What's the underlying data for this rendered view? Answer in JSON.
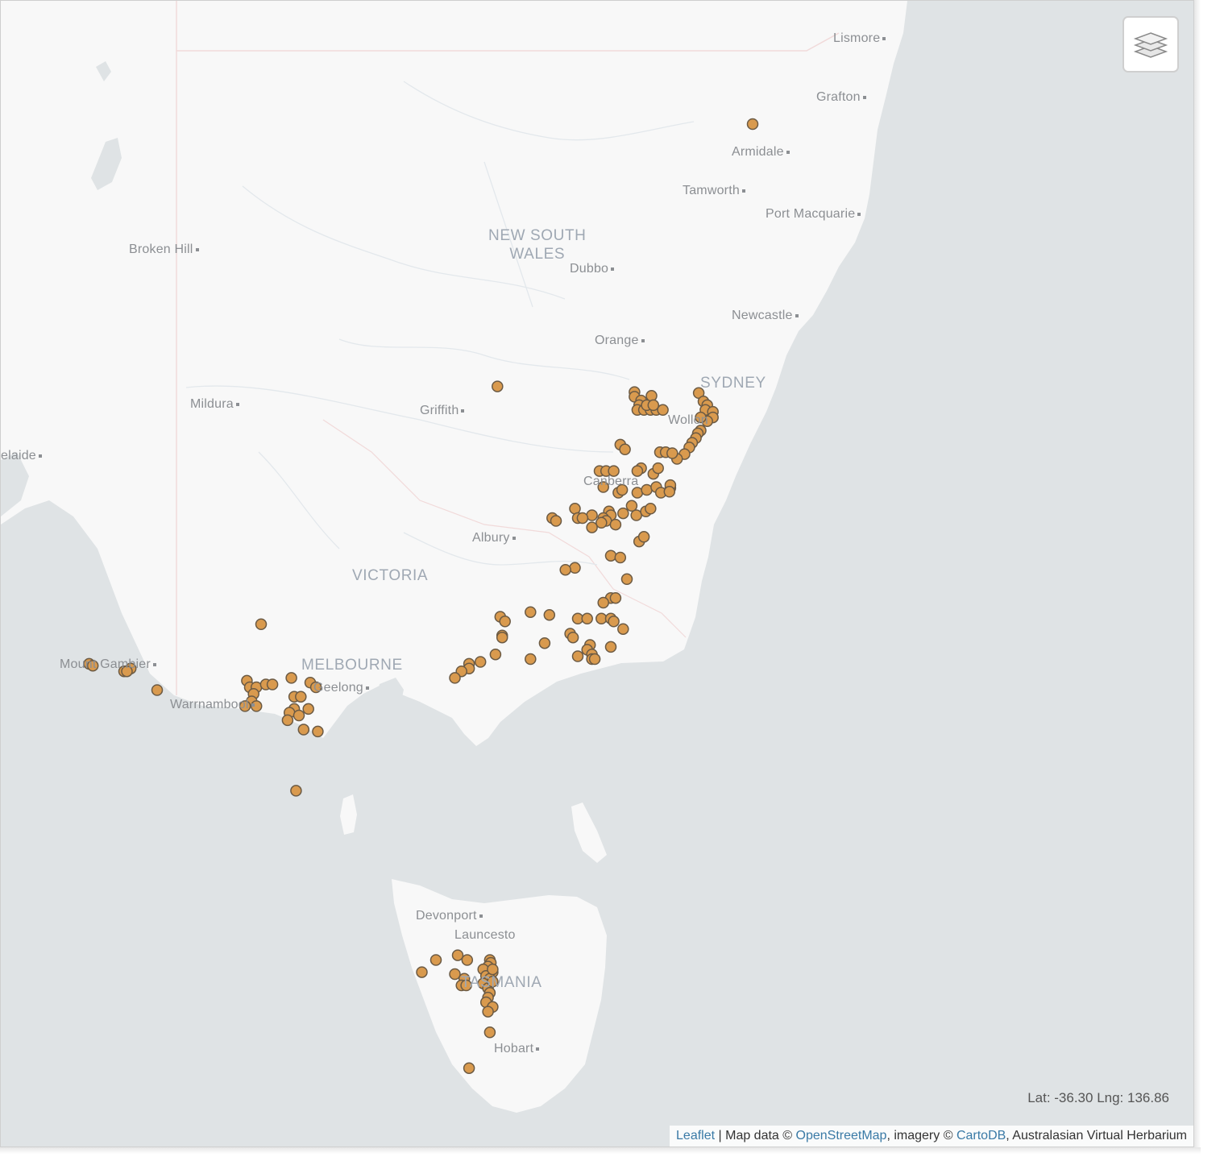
{
  "map": {
    "places": [
      {
        "id": "lismore",
        "name": "Lismore",
        "dot": true
      },
      {
        "id": "grafton",
        "name": "Grafton",
        "dot": true
      },
      {
        "id": "armidale",
        "name": "Armidale",
        "dot": true
      },
      {
        "id": "tamworth",
        "name": "Tamworth",
        "dot": true
      },
      {
        "id": "port-macquarie",
        "name": "Port Macquarie",
        "dot": true
      },
      {
        "id": "broken-hill",
        "name": "Broken Hill",
        "dot": true
      },
      {
        "id": "dubbo",
        "name": "Dubbo",
        "dot": true
      },
      {
        "id": "newcastle",
        "name": "Newcastle",
        "dot": true
      },
      {
        "id": "orange",
        "name": "Orange",
        "dot": true
      },
      {
        "id": "mildura",
        "name": "Mildura",
        "dot": true
      },
      {
        "id": "griffith",
        "name": "Griffith",
        "dot": true
      },
      {
        "id": "wollongong",
        "name": "Wollon",
        "dot": false
      },
      {
        "id": "canberra",
        "name": "Canberra",
        "dot": false
      },
      {
        "id": "adelaide",
        "name": "elaide",
        "dot": true
      },
      {
        "id": "albury",
        "name": "Albury",
        "dot": true
      },
      {
        "id": "mount-gambier",
        "name": "Mount Gambier",
        "dot": true
      },
      {
        "id": "geelong",
        "name": "Geelong",
        "dot": true
      },
      {
        "id": "warrnambool",
        "name": "Warrnambool",
        "dot": true
      },
      {
        "id": "devonport",
        "name": "Devonport",
        "dot": true
      },
      {
        "id": "launceston",
        "name": "Launcesto",
        "dot": false
      },
      {
        "id": "hobart",
        "name": "Hobart",
        "dot": true
      }
    ],
    "regions": [
      {
        "id": "nsw",
        "name": "NEW SOUTH\nWALES"
      },
      {
        "id": "victoria",
        "name": "VICTORIA"
      },
      {
        "id": "melbourne",
        "name": "MELBOURNE"
      },
      {
        "id": "sydney",
        "name": "SYDNEY"
      },
      {
        "id": "tasmania",
        "name": "TASMANIA"
      }
    ],
    "marker_style": {
      "fill": "#d99a4e",
      "stroke": "#6b5a44"
    },
    "occurrences": [
      {
        "lat": -30.46,
        "lng": 151.8
      },
      {
        "lat": -33.25,
        "lng": 149.1
      },
      {
        "lat": -33.31,
        "lng": 150.55
      },
      {
        "lat": -33.36,
        "lng": 150.55
      },
      {
        "lat": -33.4,
        "lng": 150.62
      },
      {
        "lat": -33.35,
        "lng": 150.73
      },
      {
        "lat": -33.45,
        "lng": 150.6
      },
      {
        "lat": -33.5,
        "lng": 150.58
      },
      {
        "lat": -33.5,
        "lng": 150.65
      },
      {
        "lat": -33.5,
        "lng": 150.72
      },
      {
        "lat": -33.5,
        "lng": 150.78
      },
      {
        "lat": -33.5,
        "lng": 150.85
      },
      {
        "lat": -33.45,
        "lng": 150.68
      },
      {
        "lat": -33.45,
        "lng": 150.75
      },
      {
        "lat": -33.32,
        "lng": 151.23
      },
      {
        "lat": -33.41,
        "lng": 151.28
      },
      {
        "lat": -33.45,
        "lng": 151.32
      },
      {
        "lat": -33.5,
        "lng": 151.3
      },
      {
        "lat": -33.52,
        "lng": 151.38
      },
      {
        "lat": -33.58,
        "lng": 151.38
      },
      {
        "lat": -33.62,
        "lng": 151.32
      },
      {
        "lat": -33.58,
        "lng": 151.25
      },
      {
        "lat": -33.72,
        "lng": 151.25
      },
      {
        "lat": -33.75,
        "lng": 151.22
      },
      {
        "lat": -33.8,
        "lng": 151.2
      },
      {
        "lat": -33.85,
        "lng": 151.16
      },
      {
        "lat": -33.9,
        "lng": 151.13
      },
      {
        "lat": -33.97,
        "lng": 151.08
      },
      {
        "lat": -34.02,
        "lng": 151.0
      },
      {
        "lat": -33.87,
        "lng": 150.4
      },
      {
        "lat": -33.92,
        "lng": 150.45
      },
      {
        "lat": -33.95,
        "lng": 150.82
      },
      {
        "lat": -33.95,
        "lng": 150.88
      },
      {
        "lat": -33.96,
        "lng": 150.95
      },
      {
        "lat": -34.15,
        "lng": 150.18
      },
      {
        "lat": -34.15,
        "lng": 150.25
      },
      {
        "lat": -34.15,
        "lng": 150.33
      },
      {
        "lat": -34.12,
        "lng": 150.62
      },
      {
        "lat": -34.15,
        "lng": 150.58
      },
      {
        "lat": -34.18,
        "lng": 150.75
      },
      {
        "lat": -34.12,
        "lng": 150.8
      },
      {
        "lat": -34.32,
        "lng": 150.22
      },
      {
        "lat": -34.38,
        "lng": 150.38
      },
      {
        "lat": -34.35,
        "lng": 150.42
      },
      {
        "lat": -34.38,
        "lng": 150.58
      },
      {
        "lat": -34.35,
        "lng": 150.68
      },
      {
        "lat": -34.32,
        "lng": 150.78
      },
      {
        "lat": -34.38,
        "lng": 150.83
      },
      {
        "lat": -34.33,
        "lng": 150.93
      },
      {
        "lat": -34.3,
        "lng": 150.93
      },
      {
        "lat": -34.37,
        "lng": 150.92
      },
      {
        "lat": -34.55,
        "lng": 149.92
      },
      {
        "lat": -34.65,
        "lng": 149.68
      },
      {
        "lat": -34.68,
        "lng": 149.72
      },
      {
        "lat": -34.65,
        "lng": 149.95
      },
      {
        "lat": -34.62,
        "lng": 150.1
      },
      {
        "lat": -34.58,
        "lng": 150.28
      },
      {
        "lat": -34.62,
        "lng": 150.3
      },
      {
        "lat": -34.65,
        "lng": 150.22
      },
      {
        "lat": -34.68,
        "lng": 150.25
      },
      {
        "lat": -34.72,
        "lng": 150.35
      },
      {
        "lat": -34.6,
        "lng": 150.43
      },
      {
        "lat": -34.62,
        "lng": 150.57
      },
      {
        "lat": -34.52,
        "lng": 150.52
      },
      {
        "lat": -34.58,
        "lng": 150.67
      },
      {
        "lat": -34.55,
        "lng": 150.72
      },
      {
        "lat": -34.7,
        "lng": 150.2
      },
      {
        "lat": -34.75,
        "lng": 150.1
      },
      {
        "lat": -34.65,
        "lng": 150.0
      },
      {
        "lat": -34.9,
        "lng": 150.6
      },
      {
        "lat": -34.85,
        "lng": 150.65
      },
      {
        "lat": -35.05,
        "lng": 150.3
      },
      {
        "lat": -35.07,
        "lng": 150.4
      },
      {
        "lat": -35.18,
        "lng": 149.92
      },
      {
        "lat": -35.2,
        "lng": 149.82
      },
      {
        "lat": -35.3,
        "lng": 150.47
      },
      {
        "lat": -35.5,
        "lng": 150.3
      },
      {
        "lat": -35.5,
        "lng": 150.35
      },
      {
        "lat": -35.55,
        "lng": 150.22
      },
      {
        "lat": -35.65,
        "lng": 149.45
      },
      {
        "lat": -35.68,
        "lng": 149.65
      },
      {
        "lat": -35.7,
        "lng": 149.13
      },
      {
        "lat": -35.75,
        "lng": 149.18
      },
      {
        "lat": -35.72,
        "lng": 149.95
      },
      {
        "lat": -35.72,
        "lng": 150.05
      },
      {
        "lat": -35.72,
        "lng": 150.2
      },
      {
        "lat": -35.72,
        "lng": 150.3
      },
      {
        "lat": -35.75,
        "lng": 150.33
      },
      {
        "lat": -35.83,
        "lng": 150.43
      },
      {
        "lat": -35.88,
        "lng": 149.87
      },
      {
        "lat": -35.92,
        "lng": 149.9
      },
      {
        "lat": -35.98,
        "lng": 149.6
      },
      {
        "lat": -35.9,
        "lng": 149.15
      },
      {
        "lat": -35.92,
        "lng": 149.15
      },
      {
        "lat": -36.0,
        "lng": 150.08
      },
      {
        "lat": -36.05,
        "lng": 150.05
      },
      {
        "lat": -36.1,
        "lng": 150.1
      },
      {
        "lat": -36.02,
        "lng": 150.3
      },
      {
        "lat": -36.12,
        "lng": 149.95
      },
      {
        "lat": -36.15,
        "lng": 150.1
      },
      {
        "lat": -36.15,
        "lng": 150.13
      },
      {
        "lat": -36.1,
        "lng": 149.08
      },
      {
        "lat": -36.15,
        "lng": 149.45
      },
      {
        "lat": -36.2,
        "lng": 148.8
      },
      {
        "lat": -36.18,
        "lng": 148.92
      },
      {
        "lat": -36.25,
        "lng": 148.8
      },
      {
        "lat": -36.28,
        "lng": 148.72
      },
      {
        "lat": -36.35,
        "lng": 148.65
      },
      {
        "lat": -35.78,
        "lng": 146.6
      },
      {
        "lat": -36.2,
        "lng": 144.78
      },
      {
        "lat": -36.22,
        "lng": 144.82
      },
      {
        "lat": -36.28,
        "lng": 145.15
      },
      {
        "lat": -36.25,
        "lng": 145.22
      },
      {
        "lat": -36.28,
        "lng": 145.18
      },
      {
        "lat": -36.48,
        "lng": 145.5
      },
      {
        "lat": -36.38,
        "lng": 146.45
      },
      {
        "lat": -36.45,
        "lng": 146.48
      },
      {
        "lat": -36.45,
        "lng": 146.55
      },
      {
        "lat": -36.42,
        "lng": 146.65
      },
      {
        "lat": -36.42,
        "lng": 146.72
      },
      {
        "lat": -36.52,
        "lng": 146.52
      },
      {
        "lat": -36.6,
        "lng": 146.5
      },
      {
        "lat": -36.65,
        "lng": 146.43
      },
      {
        "lat": -36.65,
        "lng": 146.55
      },
      {
        "lat": -36.35,
        "lng": 146.92
      },
      {
        "lat": -36.4,
        "lng": 147.12
      },
      {
        "lat": -36.45,
        "lng": 147.18
      },
      {
        "lat": -36.55,
        "lng": 146.95
      },
      {
        "lat": -36.55,
        "lng": 147.02
      },
      {
        "lat": -36.68,
        "lng": 146.95
      },
      {
        "lat": -36.72,
        "lng": 146.9
      },
      {
        "lat": -36.75,
        "lng": 147.0
      },
      {
        "lat": -36.68,
        "lng": 147.1
      },
      {
        "lat": -36.8,
        "lng": 146.88
      },
      {
        "lat": -36.92,
        "lng": 147.2
      },
      {
        "lat": -36.9,
        "lng": 147.05
      },
      {
        "lat": -37.55,
        "lng": 146.97
      },
      {
        "lat": -39.35,
        "lng": 148.45
      },
      {
        "lat": -39.3,
        "lng": 148.68
      },
      {
        "lat": -39.35,
        "lng": 148.78
      },
      {
        "lat": -39.48,
        "lng": 148.3
      },
      {
        "lat": -39.5,
        "lng": 148.65
      },
      {
        "lat": -39.55,
        "lng": 148.75
      },
      {
        "lat": -39.62,
        "lng": 148.72
      },
      {
        "lat": -39.62,
        "lng": 148.77
      },
      {
        "lat": -39.35,
        "lng": 149.02
      },
      {
        "lat": -39.38,
        "lng": 149.03
      },
      {
        "lat": -39.42,
        "lng": 149.0
      },
      {
        "lat": -39.45,
        "lng": 148.95
      },
      {
        "lat": -39.48,
        "lng": 149.05
      },
      {
        "lat": -39.52,
        "lng": 148.98
      },
      {
        "lat": -39.55,
        "lng": 149.02
      },
      {
        "lat": -39.6,
        "lng": 148.95
      },
      {
        "lat": -39.65,
        "lng": 149.0
      },
      {
        "lat": -39.7,
        "lng": 149.02
      },
      {
        "lat": -39.75,
        "lng": 149.0
      },
      {
        "lat": -39.8,
        "lng": 148.98
      },
      {
        "lat": -39.85,
        "lng": 149.05
      },
      {
        "lat": -39.9,
        "lng": 149.0
      },
      {
        "lat": -39.58,
        "lng": 149.05
      },
      {
        "lat": -39.45,
        "lng": 149.05
      },
      {
        "lat": -40.12,
        "lng": 149.02
      },
      {
        "lat": -40.5,
        "lng": 148.8
      }
    ]
  },
  "controls": {
    "layers_icon": "layers-icon",
    "coord_readout": "Lat: -36.30 Lng: 136.86"
  },
  "attribution": {
    "leaflet_link": "Leaflet",
    "sep1": " | Map data © ",
    "osm_link": "OpenStreetMap",
    "sep2": ", imagery © ",
    "carto_link": "CartoDB",
    "sep3": ", Australasian Virtual Herbarium"
  }
}
